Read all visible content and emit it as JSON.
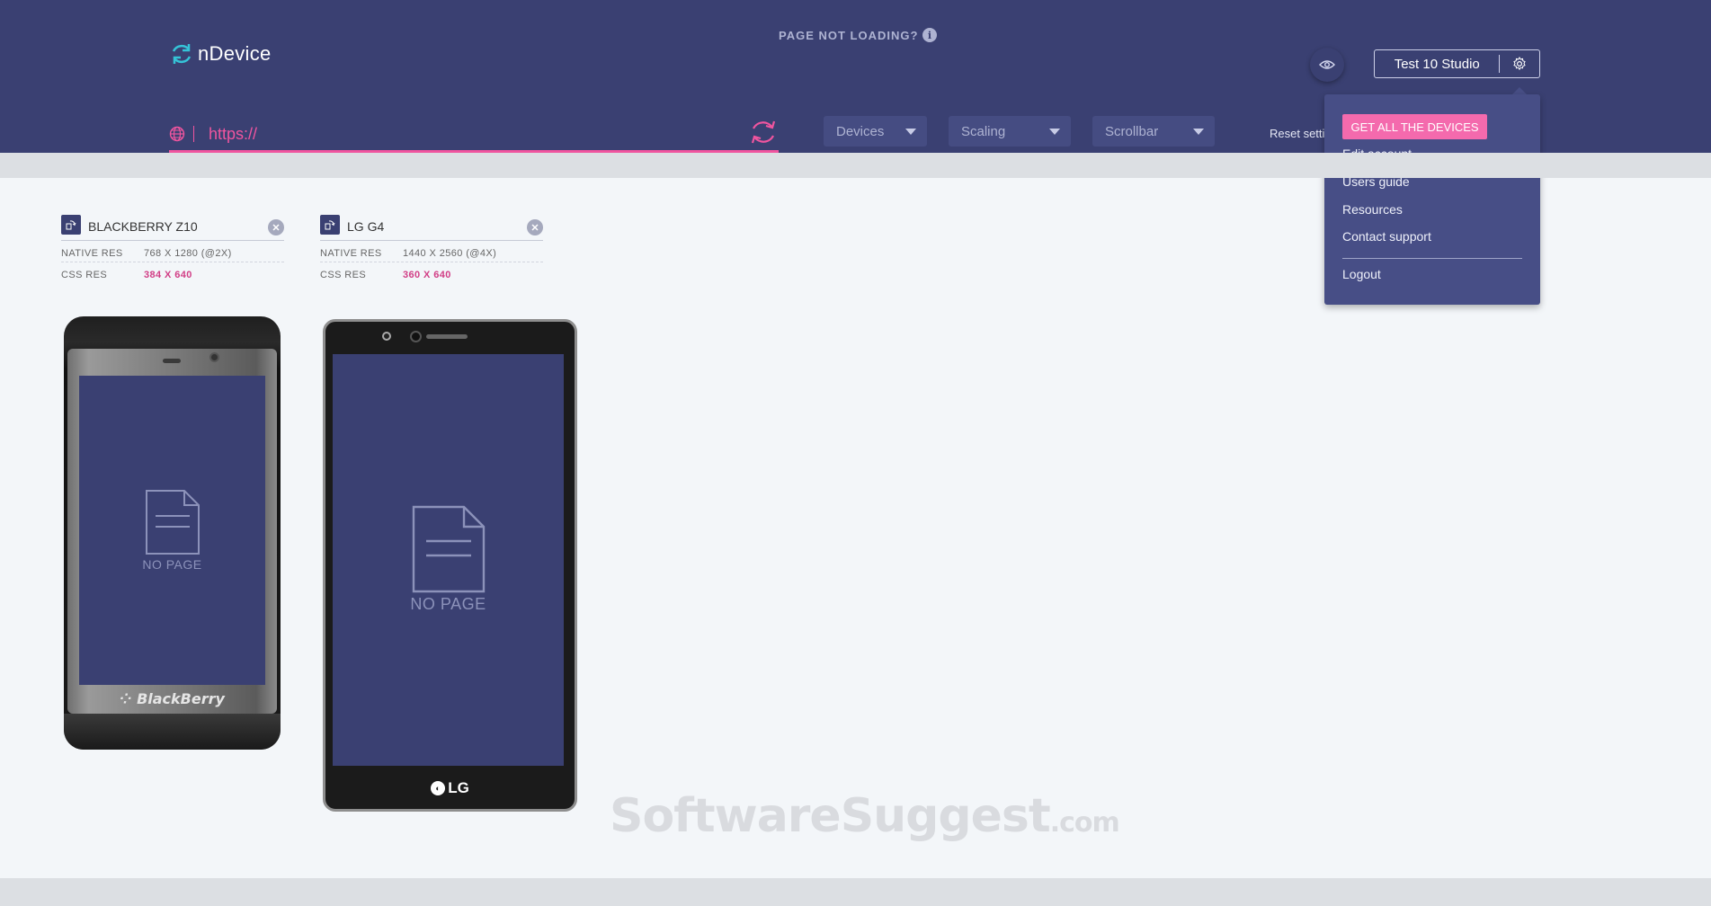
{
  "app": {
    "name": "nDevice",
    "page_not_loading": "PAGE NOT LOADING?"
  },
  "url_bar": {
    "value": "https://",
    "placeholder": "https://"
  },
  "toolbar": {
    "devices_label": "Devices",
    "scaling_label": "Scaling",
    "scrollbar_label": "Scrollbar",
    "reset_label": "Reset settings"
  },
  "account": {
    "name": "Test 10 Studio"
  },
  "account_menu": {
    "cta": "GET ALL THE DEVICES",
    "items": [
      "Edit account",
      "Users guide",
      "Resources",
      "Contact support"
    ],
    "logout": "Logout"
  },
  "devices": [
    {
      "name": "BLACKBERRY Z10",
      "native_label": "NATIVE RES",
      "native_res": "768 X 1280 (@2X)",
      "css_label": "CSS RES",
      "css_res": "384 X 640",
      "brand": "BlackBerry",
      "status": "NO PAGE"
    },
    {
      "name": "LG G4",
      "native_label": "NATIVE RES",
      "native_res": "1440 X 2560 (@4X)",
      "css_label": "CSS RES",
      "css_res": "360 X 640",
      "brand": "LG",
      "status": "NO PAGE"
    }
  ],
  "watermark": {
    "main": "SoftwareSuggest",
    "suffix": ".com"
  },
  "colors": {
    "header_bg": "#3a4072",
    "accent_pink": "#f0559f",
    "menu_bg": "#474e86",
    "cta_bg": "#f46aad"
  }
}
